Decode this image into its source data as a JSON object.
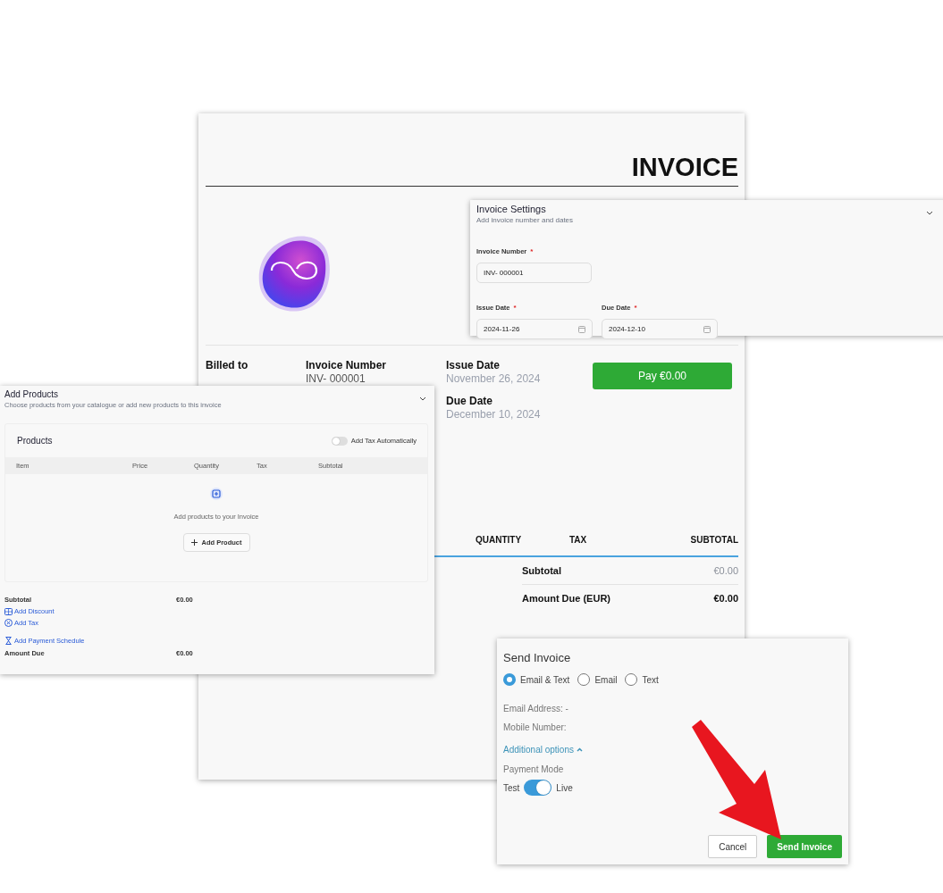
{
  "invoice_document": {
    "title": "INVOICE",
    "billed_to_label": "Billed to",
    "invoice_number_label": "Invoice Number",
    "invoice_number": "INV- 000001",
    "issue_date_label": "Issue Date",
    "issue_date": "November 26, 2024",
    "due_date_label": "Due Date",
    "due_date": "December 10, 2024",
    "pay_button": "Pay €0.00",
    "table_columns": [
      "QUANTITY",
      "TAX",
      "SUBTOTAL"
    ],
    "subtotal_label": "Subtotal",
    "subtotal": "€0.00",
    "amount_due_label": "Amount Due (EUR)",
    "amount_due": "€0.00"
  },
  "invoice_settings": {
    "title": "Invoice Settings",
    "subtitle": "Add invoice number and dates",
    "required_mark": "*",
    "fields": [
      {
        "label": "Invoice Number",
        "value": "INV- 000001",
        "required": true,
        "kind": "text"
      },
      {
        "label": "Issue Date",
        "value": "2024-11-26",
        "required": true,
        "kind": "date"
      },
      {
        "label": "Due Date",
        "value": "2024-12-10",
        "required": true,
        "kind": "date"
      }
    ]
  },
  "add_products": {
    "title": "Add Products",
    "subtitle": "Choose products from your catalogue or add new products to this invoice",
    "products_heading": "Products",
    "auto_tax": {
      "label": "Add Tax Automatically",
      "on": false
    },
    "columns": [
      "Item",
      "Price",
      "Quantity",
      "Tax",
      "Subtotal"
    ],
    "empty_message": "Add products to your Invoice",
    "add_button": "Add Product",
    "subtotal_label": "Subtotal",
    "subtotal": "€0.00",
    "links": [
      {
        "label": "Add Discount",
        "kind": "discount"
      },
      {
        "label": "Add Tax",
        "kind": "tax"
      },
      {
        "label": "Add Payment Schedule",
        "kind": "schedule"
      }
    ],
    "amount_due_label": "Amount Due",
    "amount_due": "€0.00"
  },
  "send_invoice": {
    "title": "Send Invoice",
    "options": [
      {
        "label": "Email & Text",
        "selected": true
      },
      {
        "label": "Email",
        "selected": false
      },
      {
        "label": "Text",
        "selected": false
      }
    ],
    "email_label": "Email Address: -",
    "mobile_label": "Mobile Number:",
    "additional_options": "Additional options",
    "payment_mode_label": "Payment Mode",
    "mode_off_label": "Test",
    "mode_on_label": "Live",
    "live": true,
    "buttons": [
      {
        "label": "Cancel",
        "kind": "secondary"
      },
      {
        "label": "Send Invoice",
        "kind": "primary"
      }
    ]
  }
}
